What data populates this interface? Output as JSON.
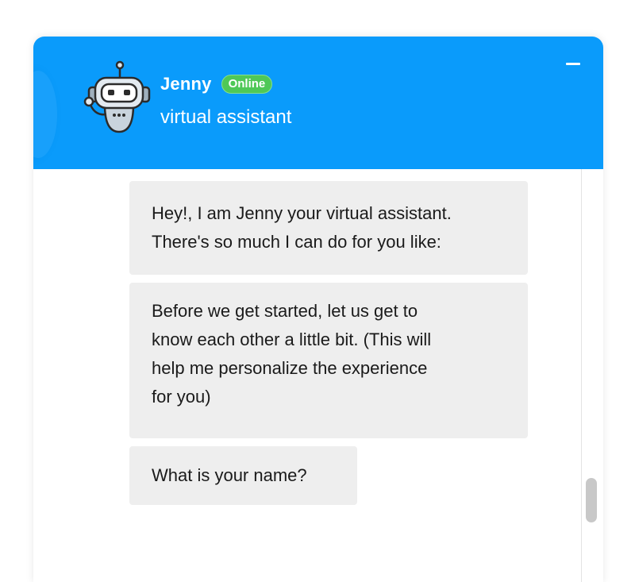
{
  "header": {
    "agent_name": "Jenny",
    "status": "Online",
    "role": "virtual assistant",
    "avatar_icon": "robot-avatar-icon",
    "minimize_icon": "minimize-icon"
  },
  "messages": [
    {
      "sender": "Jenny",
      "text": "Hey!, I am Jenny your virtual assistant.\nThere's so much I can do for you like:"
    },
    {
      "sender": "Jenny",
      "text": "Before we get started, let us get to\nknow each other a little bit. (This will\nhelp me personalize the experience\nfor you)"
    },
    {
      "sender": "Jenny",
      "text": "What is your name?"
    }
  ],
  "colors": {
    "header_background": "#0a9bfb",
    "online_badge": "#4fc857",
    "bubble_background": "#eeeeee",
    "text": "#1a1a1a"
  }
}
